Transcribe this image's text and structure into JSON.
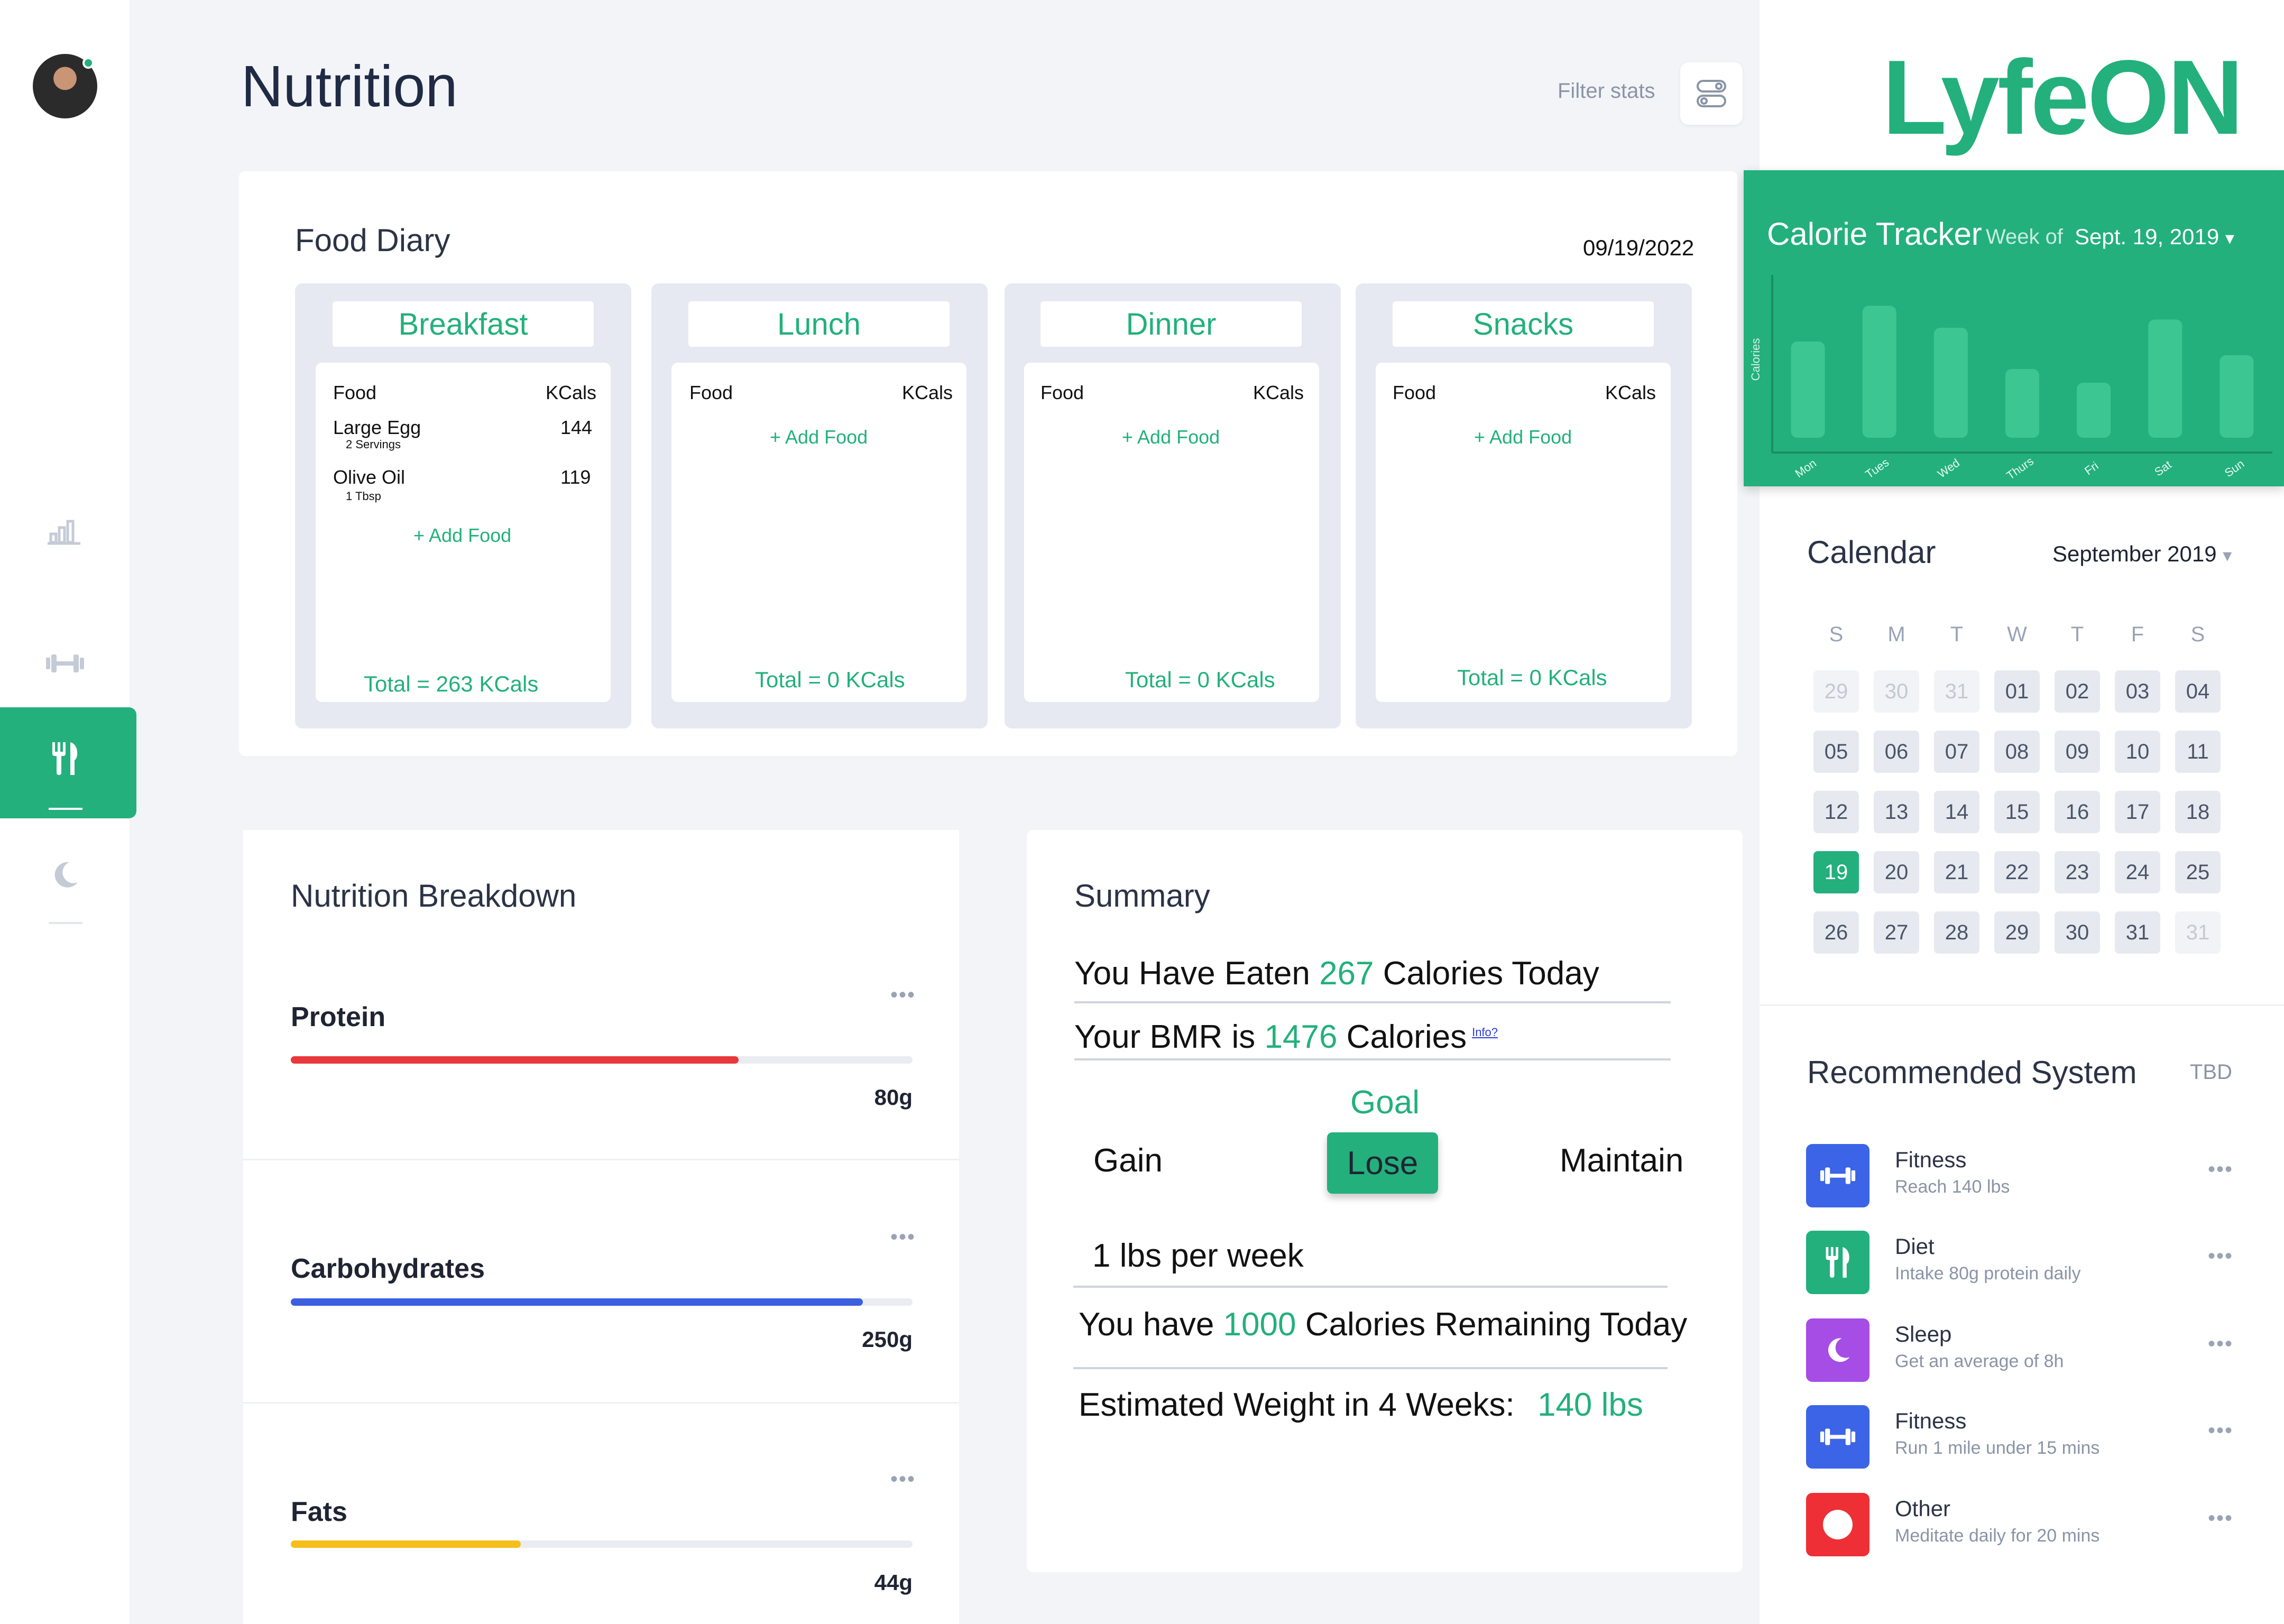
{
  "page": {
    "title": "Nutrition",
    "filter_label": "Filter stats"
  },
  "food_diary": {
    "title": "Food Diary",
    "date": "09/19/2022",
    "meals": [
      {
        "name": "Breakfast",
        "col_food": "Food",
        "col_kcals": "KCals",
        "items": [
          {
            "name": "Large Egg",
            "serving": "2 Servings",
            "kcals": "144"
          },
          {
            "name": "Olive Oil",
            "serving": "1 Tbsp",
            "kcals": "119"
          }
        ],
        "add_label": "+ Add Food",
        "total": "Total = 263 KCals"
      },
      {
        "name": "Lunch",
        "col_food": "Food",
        "col_kcals": "KCals",
        "items": [],
        "add_label": "+ Add Food",
        "total": "Total = 0 KCals"
      },
      {
        "name": "Dinner",
        "col_food": "Food",
        "col_kcals": "KCals",
        "items": [],
        "add_label": "+ Add Food",
        "total": "Total = 0 KCals"
      },
      {
        "name": "Snacks",
        "col_food": "Food",
        "col_kcals": "KCals",
        "items": [],
        "add_label": "+ Add Food",
        "total": "Total = 0 KCals"
      }
    ]
  },
  "nutrition_breakdown": {
    "title": "Nutrition Breakdown",
    "items": [
      {
        "label": "Protein",
        "value": "80g",
        "progress": 0.72,
        "color": "#e8383b"
      },
      {
        "label": "Carbohydrates",
        "value": "250g",
        "progress": 0.92,
        "color": "#3c5fe0"
      },
      {
        "label": "Fats",
        "value": "44g",
        "progress": 0.37,
        "color": "#f5be1a"
      }
    ],
    "more_label": "•••"
  },
  "summary": {
    "title": "Summary",
    "eaten_pre": "You Have Eaten ",
    "eaten_value": "267",
    "eaten_post": " Calories Today",
    "bmr_pre": "Your BMR is ",
    "bmr_value": "1476",
    "bmr_post": " Calories",
    "bmr_info": "Info?",
    "goal_label": "Goal",
    "goal_gain": "Gain",
    "goal_lose": "Lose",
    "goal_maintain": "Maintain",
    "rate": "1 lbs per week",
    "remaining_pre": "You have ",
    "remaining_value": "1000",
    "remaining_post": " Calories Remaining Today",
    "estimate_pre": "Estimated Weight in 4 Weeks: ",
    "estimate_value": "140 lbs"
  },
  "brand": {
    "logo": "LyfeON",
    "accent": "#23b07c"
  },
  "calorie_tracker": {
    "title": "Calorie Tracker",
    "week_prefix": "Week of",
    "week_date": "Sept. 19, 2019",
    "dropdown_glyph": "▾"
  },
  "chart_data": {
    "type": "bar",
    "ylabel": "Calories",
    "categories": [
      "Mon",
      "Tues",
      "Wed",
      "Thurs",
      "Fri",
      "Sat",
      "Sun"
    ],
    "values": [
      0.7,
      0.96,
      0.8,
      0.5,
      0.4,
      0.86,
      0.6
    ]
  },
  "calendar": {
    "title": "Calendar",
    "month": "September 2019",
    "dropdown_glyph": "▾",
    "weekdays": [
      "S",
      "M",
      "T",
      "W",
      "T",
      "F",
      "S"
    ],
    "weeks": [
      [
        {
          "d": "29",
          "s": "muted"
        },
        {
          "d": "30",
          "s": "muted"
        },
        {
          "d": "31",
          "s": "muted"
        },
        {
          "d": "01",
          "s": ""
        },
        {
          "d": "02",
          "s": ""
        },
        {
          "d": "03",
          "s": ""
        },
        {
          "d": "04",
          "s": ""
        }
      ],
      [
        {
          "d": "05",
          "s": ""
        },
        {
          "d": "06",
          "s": ""
        },
        {
          "d": "07",
          "s": ""
        },
        {
          "d": "08",
          "s": ""
        },
        {
          "d": "09",
          "s": ""
        },
        {
          "d": "10",
          "s": ""
        },
        {
          "d": "11",
          "s": ""
        }
      ],
      [
        {
          "d": "12",
          "s": ""
        },
        {
          "d": "13",
          "s": ""
        },
        {
          "d": "14",
          "s": ""
        },
        {
          "d": "15",
          "s": ""
        },
        {
          "d": "16",
          "s": ""
        },
        {
          "d": "17",
          "s": ""
        },
        {
          "d": "18",
          "s": ""
        }
      ],
      [
        {
          "d": "19",
          "s": "today"
        },
        {
          "d": "20",
          "s": ""
        },
        {
          "d": "21",
          "s": ""
        },
        {
          "d": "22",
          "s": ""
        },
        {
          "d": "23",
          "s": ""
        },
        {
          "d": "24",
          "s": ""
        },
        {
          "d": "25",
          "s": ""
        }
      ],
      [
        {
          "d": "26",
          "s": ""
        },
        {
          "d": "27",
          "s": ""
        },
        {
          "d": "28",
          "s": ""
        },
        {
          "d": "29",
          "s": ""
        },
        {
          "d": "30",
          "s": ""
        },
        {
          "d": "31",
          "s": ""
        },
        {
          "d": "31",
          "s": "muted"
        }
      ]
    ]
  },
  "recommended": {
    "title": "Recommended System",
    "tbd": "TBD",
    "more_label": "•••",
    "items": [
      {
        "name": "Fitness",
        "desc": "Reach 140 lbs",
        "icon": "dumbbell-icon",
        "color": "#3c64e6"
      },
      {
        "name": "Diet",
        "desc": "Intake 80g protein daily",
        "icon": "utensils-icon",
        "color": "#23b07c"
      },
      {
        "name": "Sleep",
        "desc": "Get an average of 8h",
        "icon": "moon-icon",
        "color": "#a64de6"
      },
      {
        "name": "Fitness",
        "desc": "Run 1 mile under 15 mins",
        "icon": "dumbbell-icon",
        "color": "#3c64e6"
      },
      {
        "name": "Other",
        "desc": "Meditate daily for 20 mins",
        "icon": "circle-icon",
        "color": "#ee2f35"
      }
    ]
  }
}
